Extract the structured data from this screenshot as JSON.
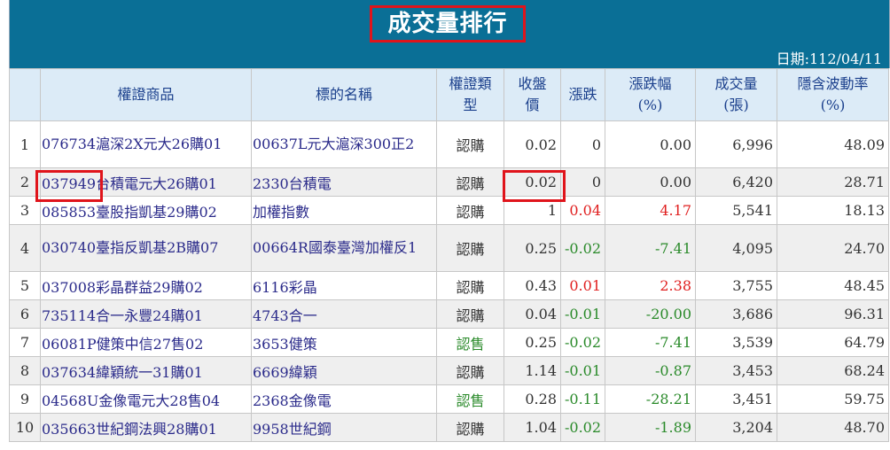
{
  "title": "成交量排行",
  "date": "日期:112/04/11",
  "headers": [
    "",
    "權證商品",
    "標的名稱",
    "權證類型",
    "收盤價",
    "漲跌",
    "漲跌幅(%)",
    "成交量(張)",
    "隱含波動率(%)"
  ],
  "header_lines": {
    "type": [
      "權證類",
      "型"
    ],
    "close": [
      "收盤",
      "價"
    ],
    "pct": [
      "漲跌幅",
      "(%)"
    ],
    "vol": [
      "成交量",
      "(張)"
    ],
    "iv": [
      "隱含波動率",
      "(%)"
    ]
  },
  "rows": [
    {
      "no": "1",
      "name": "076734滬深2X元大26購01",
      "underlying": "00637L元大滬深300正2",
      "type": "認購",
      "close": "0.02",
      "change": "0",
      "pct": "0.00",
      "volume": "6,996",
      "iv": "48.09",
      "trend": "flat"
    },
    {
      "no": "2",
      "name": "037949台積電元大26購01",
      "underlying": "2330台積電",
      "type": "認購",
      "close": "0.02",
      "change": "0",
      "pct": "0.00",
      "volume": "6,420",
      "iv": "28.71",
      "trend": "flat"
    },
    {
      "no": "3",
      "name": "085853臺股指凱基29購02",
      "underlying": "加權指數",
      "type": "認購",
      "close": "1",
      "change": "0.04",
      "pct": "4.17",
      "volume": "5,541",
      "iv": "18.13",
      "trend": "up"
    },
    {
      "no": "4",
      "name": "030740臺指反凱基2B購07",
      "underlying": "00664R國泰臺灣加權反1",
      "type": "認購",
      "close": "0.25",
      "change": "-0.02",
      "pct": "-7.41",
      "volume": "4,095",
      "iv": "24.70",
      "trend": "down"
    },
    {
      "no": "5",
      "name": "037008彩晶群益29購02",
      "underlying": "6116彩晶",
      "type": "認購",
      "close": "0.43",
      "change": "0.01",
      "pct": "2.38",
      "volume": "3,755",
      "iv": "48.45",
      "trend": "up"
    },
    {
      "no": "6",
      "name": "735114合一永豐24購01",
      "underlying": "4743合一",
      "type": "認購",
      "close": "0.04",
      "change": "-0.01",
      "pct": "-20.00",
      "volume": "3,686",
      "iv": "96.31",
      "trend": "down"
    },
    {
      "no": "7",
      "name": "06081P健策中信27售02",
      "underlying": "3653健策",
      "type": "認售",
      "close": "0.25",
      "change": "-0.02",
      "pct": "-7.41",
      "volume": "3,539",
      "iv": "64.79",
      "trend": "down"
    },
    {
      "no": "8",
      "name": "037634緯穎統一31購01",
      "underlying": "6669緯穎",
      "type": "認購",
      "close": "1.14",
      "change": "-0.01",
      "pct": "-0.87",
      "volume": "3,453",
      "iv": "68.24",
      "trend": "down"
    },
    {
      "no": "9",
      "name": "04568U金像電元大28售04",
      "underlying": "2368金像電",
      "type": "認售",
      "close": "0.28",
      "change": "-0.11",
      "pct": "-28.21",
      "volume": "3,451",
      "iv": "59.75",
      "trend": "down"
    },
    {
      "no": "10",
      "name": "035663世紀鋼法興28購01",
      "underlying": "9958世紀鋼",
      "type": "認購",
      "close": "1.04",
      "change": "-0.02",
      "pct": "-1.89",
      "volume": "3,204",
      "iv": "48.70",
      "trend": "down"
    }
  ],
  "colors": {
    "header_bar": "#0a6f96",
    "highlight": "#e0141b",
    "up": "#e02020",
    "down": "#2a8a2a",
    "header_text": "#1a3f8c"
  }
}
